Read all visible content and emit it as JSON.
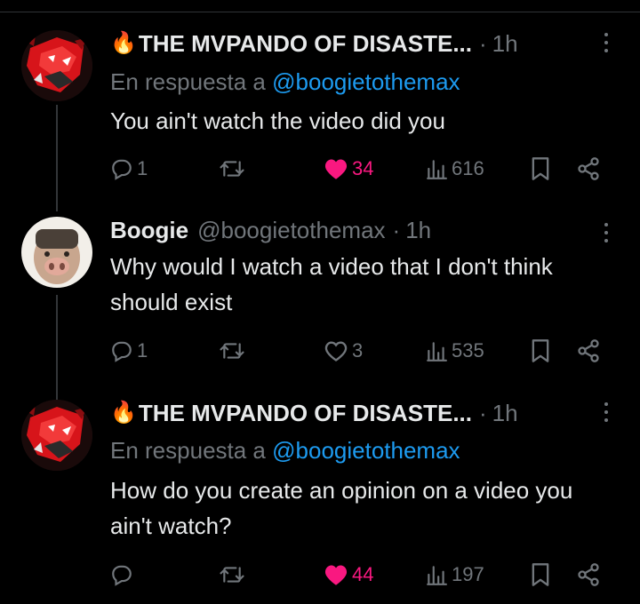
{
  "tweets": [
    {
      "emoji": "🔥",
      "name": "THE MVPANDO OF DISASTE...",
      "handle": "",
      "time": "1h",
      "replying_prefix": "En respuesta a ",
      "replying_to": "@boogietothemax",
      "text": "You ain't watch the video did you",
      "replies": "1",
      "retweets": "",
      "likes": "34",
      "liked": true,
      "views": "616",
      "avatar": "red-anime-avatar"
    },
    {
      "emoji": "",
      "name": "Boogie",
      "handle": "@boogietothemax",
      "time": "1h",
      "replying_prefix": "",
      "replying_to": "",
      "text": "Why would I watch a video that I don't think should exist",
      "replies": "1",
      "retweets": "",
      "likes": "3",
      "liked": false,
      "views": "535",
      "avatar": "pig-face-avatar"
    },
    {
      "emoji": "🔥",
      "name": "THE MVPANDO OF DISASTE...",
      "handle": "",
      "time": "1h",
      "replying_prefix": "En respuesta a ",
      "replying_to": "@boogietothemax",
      "text": "How do you create an opinion on a video you ain't watch?",
      "replies": "",
      "retweets": "",
      "likes": "44",
      "liked": true,
      "views": "197",
      "avatar": "red-anime-avatar"
    }
  ],
  "icons": {
    "reply": "reply-icon",
    "retweet": "retweet-icon",
    "like": "heart-icon",
    "views": "views-icon",
    "bookmark": "bookmark-icon",
    "share": "share-icon",
    "more": "more-icon"
  },
  "colors": {
    "background": "#000000",
    "text": "#e7e9ea",
    "muted": "#71767b",
    "mention": "#1d9bf0",
    "like": "#f91880"
  }
}
